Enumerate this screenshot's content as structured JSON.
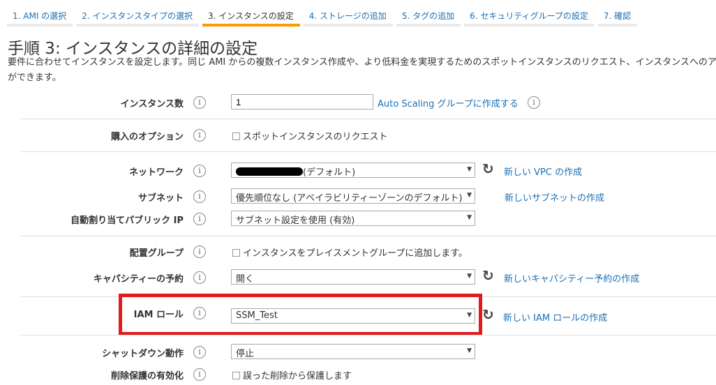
{
  "tabs": [
    "1. AMI の選択",
    "2. インスタンスタイプの選択",
    "3. インスタンスの設定",
    "4. ストレージの追加",
    "5. タグの追加",
    "6. セキュリティグループの設定",
    "7. 確認"
  ],
  "title": "手順 3: インスタンスの詳細の設定",
  "description": "要件に合わせてインスタンスを設定します。同じ AMI からの複数インスタンス作成や、より低料金を実現するためのスポットインスタンスのリクエスト、インスタンスへのアクセス管理ロールの割り当てなど",
  "description2": "ができます。",
  "info": "i",
  "rows": {
    "count": {
      "label": "インスタンス数",
      "value": "1",
      "link": "Auto Scaling グループに作成する"
    },
    "purchase": {
      "label": "購入のオプション",
      "checkbox": "スポットインスタンスのリクエスト"
    },
    "network": {
      "label": "ネットワーク",
      "value": "(デフォルト)",
      "link": "新しい VPC の作成"
    },
    "subnet": {
      "label": "サブネット",
      "value": "優先順位なし (アベイラビリティーゾーンのデフォルト)",
      "link": "新しいサブネットの作成"
    },
    "publicip": {
      "label": "自動割り当てパブリック IP",
      "value": "サブネット設定を使用 (有効)"
    },
    "placement": {
      "label": "配置グループ",
      "checkbox": "インスタンスをプレイスメントグループに追加します。"
    },
    "capacity": {
      "label": "キャパシティーの予約",
      "value": "開く",
      "link": "新しいキャパシティー予約の作成"
    },
    "iam": {
      "label": "IAM ロール",
      "value": "SSM_Test",
      "link": "新しい IAM ロールの作成"
    },
    "shutdown": {
      "label": "シャットダウン動作",
      "value": "停止"
    },
    "termination": {
      "label": "削除保護の有効化",
      "checkbox": "誤った削除から保護します"
    }
  },
  "arrow": "▼",
  "refresh": "↻"
}
